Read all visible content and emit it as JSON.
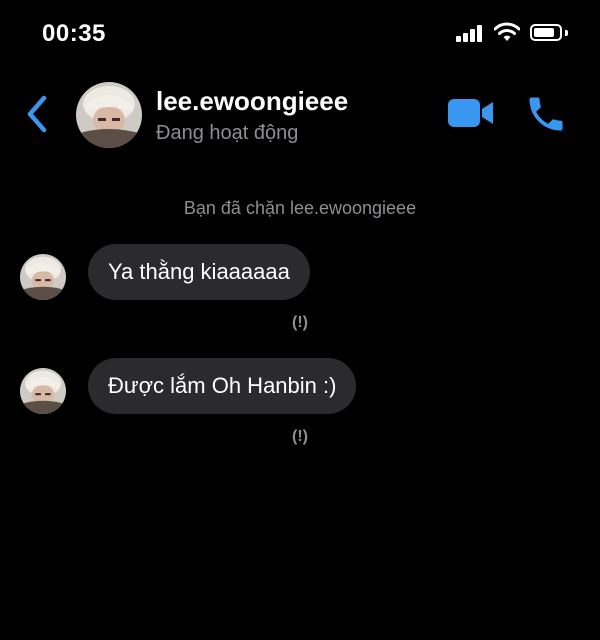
{
  "status_bar": {
    "time": "00:35",
    "icons": [
      "signal-icon",
      "wifi-icon",
      "battery-icon"
    ]
  },
  "header": {
    "username": "lee.ewoongieee",
    "activity_status": "Đang hoạt động",
    "icons": [
      "back-arrow-icon",
      "video-call-icon",
      "phone-call-icon"
    ],
    "accent_color": "#3897f0"
  },
  "conversation": {
    "blocked_notice": "Bạn đã chặn lee.ewoongieee",
    "messages": [
      {
        "text": "Ya thằng kiaaaaaa",
        "error_mark": "(!)"
      },
      {
        "text": "Được lắm Oh Hanbin :)",
        "error_mark": "(!)"
      }
    ]
  },
  "colors": {
    "background": "#000000",
    "bubble": "#2b2b2d",
    "secondary_text": "#8e8e93"
  }
}
